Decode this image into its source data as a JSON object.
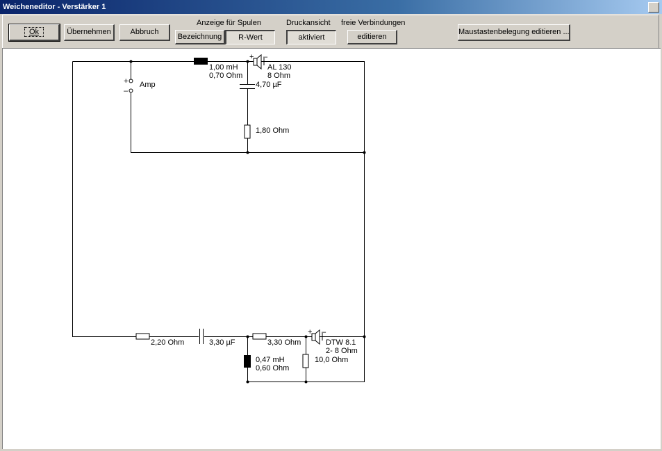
{
  "window": {
    "title": "Weicheneditor - Verstärker 1"
  },
  "toolbar": {
    "ok": "Ok",
    "uebernehmen": "Übernehmen",
    "abbruch": "Abbruch",
    "anzeige_label": "Anzeige für Spulen",
    "bezeichnung": "Bezeichnung",
    "rwert": "R-Wert",
    "druck_label": "Druckansicht",
    "aktiviert": "aktiviert",
    "freie_label": "freie Verbindungen",
    "editieren": "editieren",
    "maus": "Maustastenbelegung editieren ..."
  },
  "schematic": {
    "amp": "Amp",
    "amp_plus": "+",
    "amp_minus": "–",
    "l1_val": "1,00 mH",
    "l1_r": "0,70 Ohm",
    "spk1_name": "AL 130",
    "spk1_imp": "8 Ohm",
    "c1_val": "4,70 µF",
    "r1_val": "1,80 Ohm",
    "r2_val": "2,20 Ohm",
    "c2_val": "3,30 µF",
    "r3_val": "3,30 Ohm",
    "spk2_name": "DTW 8.1",
    "spk2_imp": "2- 8 Ohm",
    "l2_val": "0,47 mH",
    "l2_r": "0,60 Ohm",
    "r4_val": "10,0 Ohm",
    "plus": "+",
    "minus": "–"
  }
}
